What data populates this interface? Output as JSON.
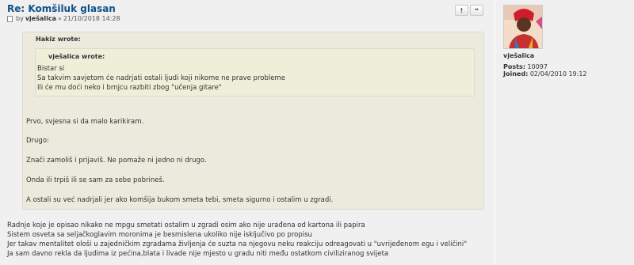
{
  "post": {
    "title": "Re: Komšiluk glasan",
    "by": "by",
    "author": "vješalica",
    "separator": "»",
    "date": "21/10/2018 14:28",
    "report_label": "!",
    "quote_label": "❝"
  },
  "outer_quote": {
    "cite": "Hakiz wrote:",
    "inner_quote": {
      "cite": "vješalica wrote:",
      "lines": [
        "Bistar si",
        "Sa takvim savjetom će nadrjati ostali ljudi koji nikome ne prave probleme",
        "Ili će mu doći neko i brnjcu razbiti zbog \"učenja gitare\""
      ]
    },
    "lines": [
      "Prvo, svjesna si da malo karikiram.",
      "Drugo:",
      "Znači zamoliš i prijaviš. Ne pomaže ni jedno ni drugo.",
      "Onda ili trpiš ili se sam za sebe pobrineš.",
      "A ostali su već nadrjali jer ako komšija bukom smeta tebi, smeta sigurno i ostalim u zgradi."
    ]
  },
  "body_lines": [
    "Radnje koje je opisao nikako ne mpgu smetati ostalim u zgradi osim ako nije urađena od kartona ili papira",
    "Sistem osveta sa seljačkoglavim moronima je besmislena ukoliko nije isključivo po propisu",
    "Jer takav mentalitet ološi u zajedničkim zgradama življenja će suzta na njegovu neku reakciju odreagovati u \"uvrijeđenom egu i veličini\"",
    "Ja sam davno rekla da ljudima iz pećina,blata i livade nije mjesto u gradu niti među ostatkom civiliziranog svijeta"
  ],
  "profile": {
    "username": "vješalica",
    "posts_label": "Posts:",
    "posts_value": "10097",
    "joined_label": "Joined:",
    "joined_value": "02/04/2010 19:12"
  },
  "colors": {
    "title": "#105289",
    "quote_bg": "#ebeadd",
    "inner_quote_bg": "#efeed9",
    "page_bg": "#f0f0f0"
  }
}
